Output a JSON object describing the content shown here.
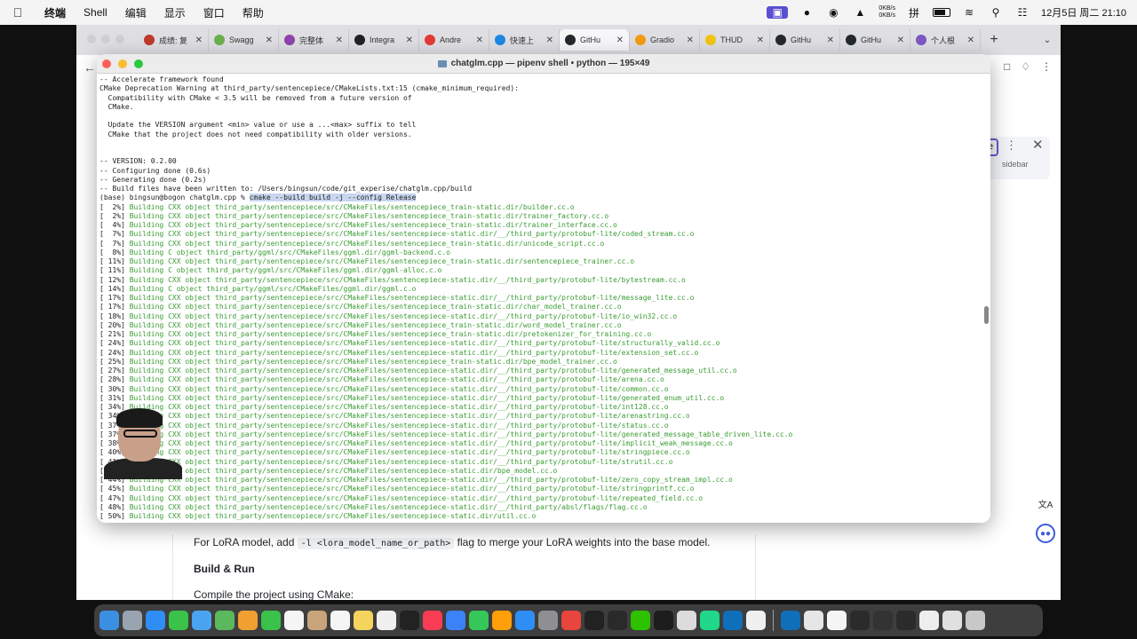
{
  "menubar": {
    "apple": "",
    "app_name": "终端",
    "items": [
      "Shell",
      "编辑",
      "显示",
      "窗口",
      "帮助"
    ],
    "net_up": "0KB/s",
    "net_down": "0KB/s",
    "input_method": "拼",
    "datetime": "12月5日 周二  21:10"
  },
  "browser": {
    "tabs": [
      {
        "label": "成绩: 复",
        "color": "#c0392b",
        "icon": "grades-icon"
      },
      {
        "label": "Swagg",
        "color": "#6ab04c",
        "icon": "swagger-icon"
      },
      {
        "label": "完整体",
        "color": "#8e44ad",
        "icon": "b-icon"
      },
      {
        "label": "Integra",
        "color": "#222222",
        "icon": "integra-icon"
      },
      {
        "label": "Andre",
        "color": "#e53935",
        "icon": "youtube-icon"
      },
      {
        "label": "快速上",
        "color": "#1e88e5",
        "icon": "cloud-icon"
      },
      {
        "label": "GitHu",
        "color": "#24292f",
        "icon": "github-icon",
        "active": true
      },
      {
        "label": "Gradio",
        "color": "#f39c12",
        "icon": "gradio-icon"
      },
      {
        "label": "THUD",
        "color": "#f1c40f",
        "icon": "hf-icon"
      },
      {
        "label": "GitHu",
        "color": "#24292f",
        "icon": "github-icon"
      },
      {
        "label": "GitHu",
        "color": "#24292f",
        "icon": "github-icon"
      },
      {
        "label": "个人根",
        "color": "#7e57c2",
        "icon": "personal-icon"
      }
    ],
    "sidebar_label": "sidebar"
  },
  "doc": {
    "lora_prefix": "For LoRA model, add ",
    "lora_code": "-l <lora_model_name_or_path>",
    "lora_suffix": " flag to merge your LoRA weights into the base model.",
    "build_heading": "Build & Run",
    "compile_text": "Compile the project using CMake:"
  },
  "terminal": {
    "title": "chatglm.cpp — pipenv shell • python — 195×49",
    "header_lines": [
      "-- Accelerate framework found",
      "CMake Deprecation Warning at third_party/sentencepiece/CMakeLists.txt:15 (cmake_minimum_required):",
      "  Compatibility with CMake < 3.5 will be removed from a future version of",
      "  CMake.",
      "",
      "  Update the VERSION argument <min> value or use a ...<max> suffix to tell",
      "  CMake that the project does not need compatibility with older versions.",
      "",
      "",
      "-- VERSION: 0.2.00",
      "-- Configuring done (0.6s)",
      "-- Generating done (0.2s)",
      "-- Build files have been written to: /Users/bingsun/code/git_experise/chatglm.cpp/build"
    ],
    "prompt": "(base) bingsun@bogon chatglm.cpp % ",
    "command": "cmake --build build -j --config Release",
    "build_lines": [
      {
        "pct": "[  2%]",
        "text": "Building CXX object third_party/sentencepiece/src/CMakeFiles/sentencepiece_train-static.dir/builder.cc.o"
      },
      {
        "pct": "[  2%]",
        "text": "Building CXX object third_party/sentencepiece/src/CMakeFiles/sentencepiece_train-static.dir/trainer_factory.cc.o"
      },
      {
        "pct": "[  4%]",
        "text": "Building CXX object third_party/sentencepiece/src/CMakeFiles/sentencepiece_train-static.dir/trainer_interface.cc.o"
      },
      {
        "pct": "[  7%]",
        "text": "Building CXX object third_party/sentencepiece/src/CMakeFiles/sentencepiece-static.dir/__/third_party/protobuf-lite/coded_stream.cc.o"
      },
      {
        "pct": "[  7%]",
        "text": "Building CXX object third_party/sentencepiece/src/CMakeFiles/sentencepiece_train-static.dir/unicode_script.cc.o"
      },
      {
        "pct": "[  8%]",
        "text": "Building C object third_party/ggml/src/CMakeFiles/ggml.dir/ggml-backend.c.o"
      },
      {
        "pct": "[ 11%]",
        "text": "Building CXX object third_party/sentencepiece/src/CMakeFiles/sentencepiece_train-static.dir/sentencepiece_trainer.cc.o"
      },
      {
        "pct": "[ 11%]",
        "text": "Building C object third_party/ggml/src/CMakeFiles/ggml.dir/ggml-alloc.c.o"
      },
      {
        "pct": "[ 12%]",
        "text": "Building CXX object third_party/sentencepiece/src/CMakeFiles/sentencepiece-static.dir/__/third_party/protobuf-lite/bytestream.cc.o"
      },
      {
        "pct": "[ 14%]",
        "text": "Building C object third_party/ggml/src/CMakeFiles/ggml.dir/ggml.c.o"
      },
      {
        "pct": "[ 17%]",
        "text": "Building CXX object third_party/sentencepiece/src/CMakeFiles/sentencepiece-static.dir/__/third_party/protobuf-lite/message_lite.cc.o"
      },
      {
        "pct": "[ 17%]",
        "text": "Building CXX object third_party/sentencepiece/src/CMakeFiles/sentencepiece_train-static.dir/char_model_trainer.cc.o"
      },
      {
        "pct": "[ 18%]",
        "text": "Building CXX object third_party/sentencepiece/src/CMakeFiles/sentencepiece-static.dir/__/third_party/protobuf-lite/io_win32.cc.o"
      },
      {
        "pct": "[ 20%]",
        "text": "Building CXX object third_party/sentencepiece/src/CMakeFiles/sentencepiece_train-static.dir/word_model_trainer.cc.o"
      },
      {
        "pct": "[ 21%]",
        "text": "Building CXX object third_party/sentencepiece/src/CMakeFiles/sentencepiece_train-static.dir/pretokenizer_for_training.cc.o"
      },
      {
        "pct": "[ 24%]",
        "text": "Building CXX object third_party/sentencepiece/src/CMakeFiles/sentencepiece-static.dir/__/third_party/protobuf-lite/structurally_valid.cc.o"
      },
      {
        "pct": "[ 24%]",
        "text": "Building CXX object third_party/sentencepiece/src/CMakeFiles/sentencepiece-static.dir/__/third_party/protobuf-lite/extension_set.cc.o"
      },
      {
        "pct": "[ 25%]",
        "text": "Building CXX object third_party/sentencepiece/src/CMakeFiles/sentencepiece_train-static.dir/bpe_model_trainer.cc.o"
      },
      {
        "pct": "[ 27%]",
        "text": "Building CXX object third_party/sentencepiece/src/CMakeFiles/sentencepiece-static.dir/__/third_party/protobuf-lite/generated_message_util.cc.o"
      },
      {
        "pct": "[ 28%]",
        "text": "Building CXX object third_party/sentencepiece/src/CMakeFiles/sentencepiece-static.dir/__/third_party/protobuf-lite/arena.cc.o"
      },
      {
        "pct": "[ 30%]",
        "text": "Building CXX object third_party/sentencepiece/src/CMakeFiles/sentencepiece-static.dir/__/third_party/protobuf-lite/common.cc.o"
      },
      {
        "pct": "[ 31%]",
        "text": "Building CXX object third_party/sentencepiece/src/CMakeFiles/sentencepiece-static.dir/__/third_party/protobuf-lite/generated_enum_util.cc.o"
      },
      {
        "pct": "[ 34%]",
        "text": "Building CXX object third_party/sentencepiece/src/CMakeFiles/sentencepiece-static.dir/__/third_party/protobuf-lite/int128.cc.o"
      },
      {
        "pct": "[ 34%]",
        "text": "Building CXX object third_party/sentencepiece/src/CMakeFiles/sentencepiece-static.dir/__/third_party/protobuf-lite/arenastring.cc.o"
      },
      {
        "pct": "[ 37%]",
        "text": "Building CXX object third_party/sentencepiece/src/CMakeFiles/sentencepiece-static.dir/__/third_party/protobuf-lite/status.cc.o"
      },
      {
        "pct": "[ 37%]",
        "text": "Building CXX object third_party/sentencepiece/src/CMakeFiles/sentencepiece-static.dir/__/third_party/protobuf-lite/generated_message_table_driven_lite.cc.o"
      },
      {
        "pct": "[ 38%]",
        "text": "Building CXX object third_party/sentencepiece/src/CMakeFiles/sentencepiece-static.dir/__/third_party/protobuf-lite/implicit_weak_message.cc.o"
      },
      {
        "pct": "[ 40%]",
        "text": "Building CXX object third_party/sentencepiece/src/CMakeFiles/sentencepiece-static.dir/__/third_party/protobuf-lite/stringpiece.cc.o"
      },
      {
        "pct": "[ 41%]",
        "text": "Building CXX object third_party/sentencepiece/src/CMakeFiles/sentencepiece-static.dir/__/third_party/protobuf-lite/strutil.cc.o"
      },
      {
        "pct": "[ 42%]",
        "text": "Building CXX object third_party/sentencepiece/src/CMakeFiles/sentencepiece-static.dir/bpe_model.cc.o"
      },
      {
        "pct": "[ 44%]",
        "text": "Building CXX object third_party/sentencepiece/src/CMakeFiles/sentencepiece-static.dir/__/third_party/protobuf-lite/zero_copy_stream_impl.cc.o"
      },
      {
        "pct": "[ 45%]",
        "text": "Building CXX object third_party/sentencepiece/src/CMakeFiles/sentencepiece-static.dir/__/third_party/protobuf-lite/stringprintf.cc.o"
      },
      {
        "pct": "[ 47%]",
        "text": "Building CXX object third_party/sentencepiece/src/CMakeFiles/sentencepiece-static.dir/__/third_party/protobuf-lite/repeated_field.cc.o"
      },
      {
        "pct": "[ 48%]",
        "text": "Building CXX object third_party/sentencepiece/src/CMakeFiles/sentencepiece-static.dir/__/third_party/absl/flags/flag.cc.o"
      },
      {
        "pct": "[ 50%]",
        "text": "Building CXX object third_party/sentencepiece/src/CMakeFiles/sentencepiece-static.dir/util.cc.o"
      }
    ]
  },
  "dock": {
    "icons": [
      {
        "name": "finder-icon",
        "color": "#3b8fe0"
      },
      {
        "name": "launchpad-icon",
        "color": "#9aa3b0"
      },
      {
        "name": "safari-icon",
        "color": "#2f8ef5"
      },
      {
        "name": "messages-icon",
        "color": "#3ac24a"
      },
      {
        "name": "mail-icon",
        "color": "#4aa3f0"
      },
      {
        "name": "maps-icon",
        "color": "#5cb85c"
      },
      {
        "name": "photos-icon",
        "color": "#f0a030"
      },
      {
        "name": "facetime-icon",
        "color": "#3ac24a"
      },
      {
        "name": "calendar-icon",
        "color": "#f5f5f5"
      },
      {
        "name": "contacts-icon",
        "color": "#c7a47a"
      },
      {
        "name": "reminders-icon",
        "color": "#f5f5f5"
      },
      {
        "name": "notes-icon",
        "color": "#f4d35e"
      },
      {
        "name": "freeform-icon",
        "color": "#f0f0f0"
      },
      {
        "name": "tv-icon",
        "color": "#222222"
      },
      {
        "name": "music-icon",
        "color": "#fa3c55"
      },
      {
        "name": "keynote-icon",
        "color": "#3b82f6"
      },
      {
        "name": "numbers-icon",
        "color": "#34c759"
      },
      {
        "name": "pages-icon",
        "color": "#ff9f0a"
      },
      {
        "name": "appstore-icon",
        "color": "#2f8ef5"
      },
      {
        "name": "settings-icon",
        "color": "#8e8e93"
      },
      {
        "name": "chrome-icon",
        "color": "#e8453c"
      },
      {
        "name": "terminal-icon",
        "color": "#222222"
      },
      {
        "name": "chatgpt-icon",
        "color": "#2a2a2a"
      },
      {
        "name": "wechat-icon",
        "color": "#2dc100"
      },
      {
        "name": "activity-monitor-icon",
        "color": "#1d1d1d"
      },
      {
        "name": "screenshot-icon",
        "color": "#dcdcdc"
      },
      {
        "name": "pycharm-icon",
        "color": "#21d789"
      },
      {
        "name": "vscode-icon",
        "color": "#0f6fb8"
      },
      {
        "name": "textedit-icon",
        "color": "#f0f0f0"
      },
      {
        "name": "sep",
        "color": ""
      },
      {
        "name": "vscode-window-icon",
        "color": "#0f6fb8"
      },
      {
        "name": "window-thumb-1-icon",
        "color": "#e6e6e6"
      },
      {
        "name": "window-thumb-2-icon",
        "color": "#f5f5f5"
      },
      {
        "name": "window-thumb-3-icon",
        "color": "#2b2b2b"
      },
      {
        "name": "window-thumb-4-icon",
        "color": "#333333"
      },
      {
        "name": "window-thumb-5-icon",
        "color": "#2b2b2b"
      },
      {
        "name": "window-thumb-6-icon",
        "color": "#eeeeee"
      },
      {
        "name": "window-thumb-7-icon",
        "color": "#e0e0e0"
      },
      {
        "name": "trash-icon",
        "color": "#c8c8c8"
      }
    ]
  },
  "colors": {
    "terminal_green": "#3a9c33",
    "selection": "#c8d6ef",
    "accent_purple": "#6a5acd"
  }
}
